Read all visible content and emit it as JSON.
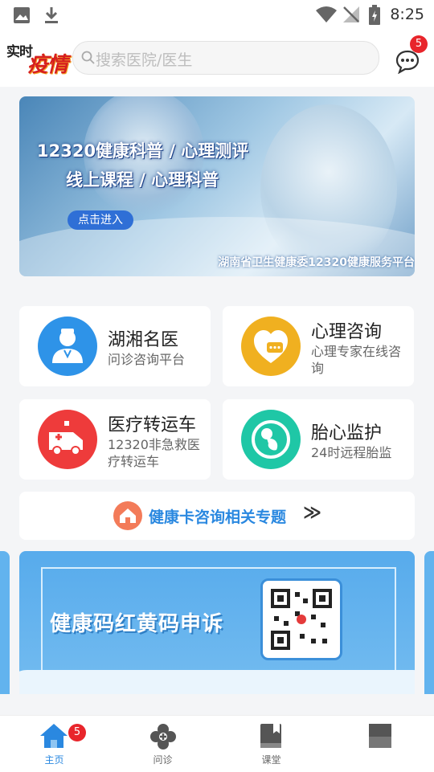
{
  "status_bar": {
    "time": "8:25"
  },
  "header": {
    "logo": {
      "line1": "实时",
      "line2": "疫情"
    },
    "search_placeholder": "搜索医院/医生",
    "message_badge": "5"
  },
  "banner": {
    "line1": "12320健康科普 / 心理测评",
    "line2": "线上课程 / 心理科普",
    "button": "点击进入",
    "footer": "湖南省卫生健康委12320健康服务平台"
  },
  "services": [
    {
      "title": "湖湘名医",
      "subtitle": "问诊咨询平台",
      "icon": "doctor-icon",
      "color": "#2e93e8"
    },
    {
      "title": "心理咨询",
      "subtitle": "心理专家在线咨询",
      "icon": "heart-chat-icon",
      "color": "#f0b020"
    },
    {
      "title": "医疗转运车",
      "subtitle": "12320非急救医疗转运车",
      "icon": "ambulance-icon",
      "color": "#ee3b3b"
    },
    {
      "title": "胎心监护",
      "subtitle": "24时远程胎监",
      "icon": "fetus-icon",
      "color": "#1fc7a6"
    }
  ],
  "health_topic": {
    "label": "健康卡咨询相关专题",
    "arrow": "≫"
  },
  "promo": {
    "title": "健康码红黄码申诉"
  },
  "bottom_nav": [
    {
      "label": "主页",
      "icon": "home-icon",
      "badge": "5"
    },
    {
      "label": "问诊",
      "icon": "clover-icon"
    },
    {
      "label": "课堂",
      "icon": "book-icon"
    },
    {
      "label": "",
      "icon": "profile-icon"
    }
  ]
}
